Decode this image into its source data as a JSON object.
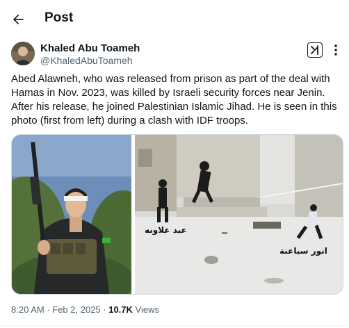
{
  "header": {
    "title": "Post",
    "back_icon": "arrow-left-icon"
  },
  "author": {
    "name": "Khaled Abu Toameh",
    "handle": "@KhaledAbuToameh"
  },
  "post": {
    "text": "Abed Alawneh, who was released from prison as part of the deal with Hamas in Nov. 2023, was killed by Israeli security forces near Jenin. After his release, he joined Palestinian Islamic Jihad. He is seen in this photo (first from left) during a clash with IDF troops."
  },
  "media": {
    "right_labels": [
      "عبد علاونه",
      "انور سباعنة"
    ]
  },
  "meta": {
    "time": "8:20 AM",
    "separator1": " · ",
    "date": "Feb 2, 2025",
    "separator2": " · ",
    "views_count": "10.7K",
    "views_label": " Views"
  },
  "icons": {
    "grok": "grok-icon",
    "more": "more-dots-icon"
  }
}
